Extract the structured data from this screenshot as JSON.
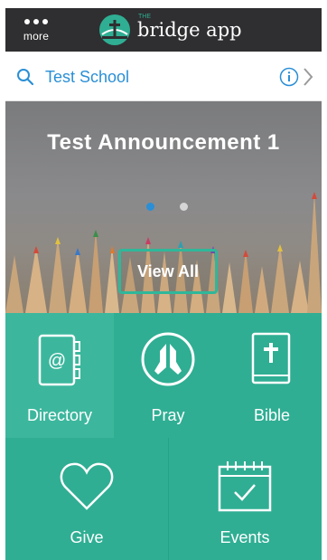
{
  "header": {
    "more_label": "more",
    "brand_small": "THE",
    "brand_name": "bridge app",
    "logo_icon": "bridge-cross-logo"
  },
  "search": {
    "school_name": "Test School",
    "icons": [
      "search-icon",
      "info-icon",
      "chevron-right-icon"
    ]
  },
  "hero": {
    "announcement_title": "Test Announcement 1",
    "pager_count": 2,
    "pager_active_index": 0,
    "view_all_label": "View All"
  },
  "tiles": [
    {
      "label": "Directory",
      "icon": "address-book-icon"
    },
    {
      "label": "Pray",
      "icon": "praying-hands-icon"
    },
    {
      "label": "Bible",
      "icon": "bible-icon"
    },
    {
      "label": "Give",
      "icon": "heart-icon"
    },
    {
      "label": "Events",
      "icon": "calendar-icon"
    }
  ],
  "colors": {
    "topbar": "#2f2e30",
    "accent": "#2fae93",
    "link_blue": "#2a8fd6",
    "pager_active": "#2a8fd6",
    "pager_inactive": "#d6d6d6"
  }
}
